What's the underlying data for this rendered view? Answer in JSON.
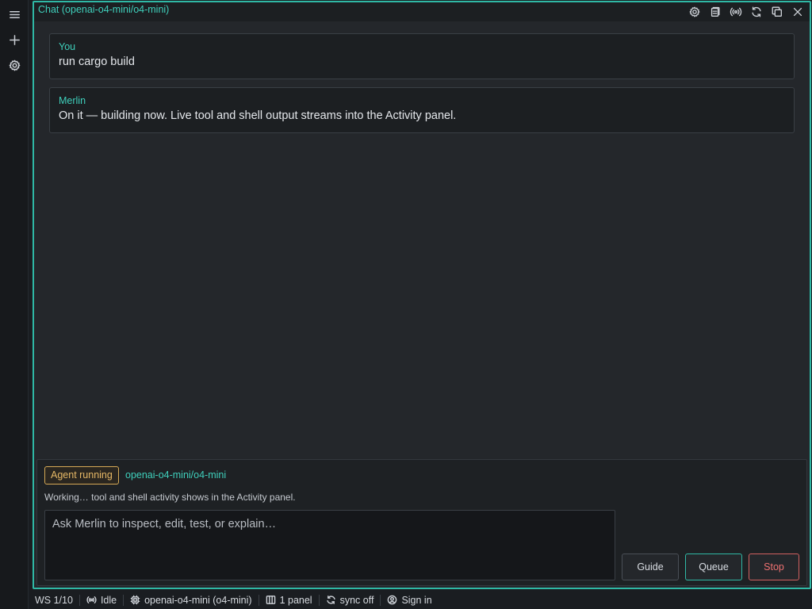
{
  "rail": {
    "menu_icon": "hamburger-menu-icon",
    "new_icon": "plus-icon",
    "settings_icon": "gear-icon"
  },
  "panel": {
    "title": "Chat (openai-o4-mini/o4-mini)",
    "actions": [
      "gear-icon",
      "clipboard-icon",
      "broadcast-icon",
      "refresh-icon",
      "copy-icon",
      "close-icon"
    ]
  },
  "messages": [
    {
      "author": "You",
      "text": "run cargo build"
    },
    {
      "author": "Merlin",
      "text": "On it — building now. Live tool and shell output streams into the Activity panel."
    }
  ],
  "composer": {
    "badge": "Agent running",
    "model": "openai-o4-mini/o4-mini",
    "status": "Working… tool and shell activity shows in the Activity panel.",
    "placeholder": "Ask Merlin to inspect, edit, test, or explain…",
    "guide_label": "Guide",
    "queue_label": "Queue",
    "stop_label": "Stop"
  },
  "statusbar": {
    "workspace": "WS 1/10",
    "state": "Idle",
    "model": "openai-o4-mini (o4-mini)",
    "panels": "1 panel",
    "sync": "sync off",
    "signin": "Sign in"
  },
  "colors": {
    "accent": "#2fb8a5",
    "badge": "#d6a955",
    "stop": "#d06060"
  }
}
